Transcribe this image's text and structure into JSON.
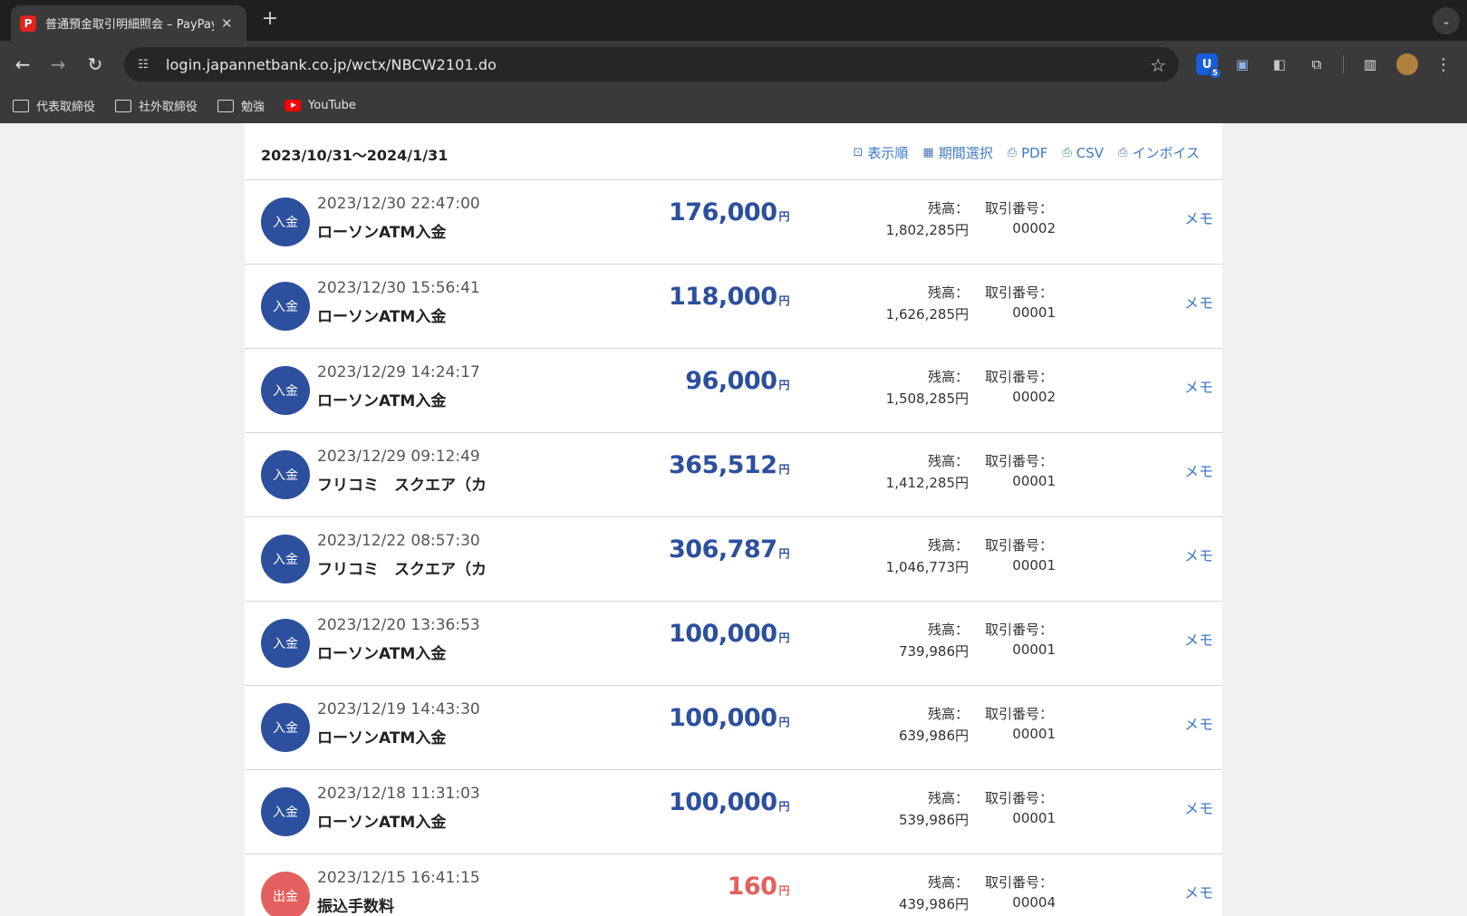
{
  "browser": {
    "tab_title": "普通預金取引明細照会 – PayPay銀行",
    "url": "login.japannetbank.co.jp/wctx/NBCW2101.do",
    "bookmarks": [
      "代表取締役",
      "社外取締役",
      "勉強",
      "YouTube"
    ],
    "extension_badge": "5"
  },
  "header": {
    "period": "2023/10/31〜2024/1/31",
    "actions": [
      "表示順",
      "期間選択",
      "PDF",
      "CSV",
      "インボイス"
    ]
  },
  "labels": {
    "balance": "残高：",
    "tx_no": "取引番号：",
    "memo": "メモ",
    "yen": "円"
  },
  "transactions": [
    {
      "type": "入金",
      "kind": "in",
      "datetime": "2023/12/30 22:47:00",
      "description": "ローソンATM入金",
      "amount": "176,000",
      "balance": "1,802,285円",
      "tx_no": "00002"
    },
    {
      "type": "入金",
      "kind": "in",
      "datetime": "2023/12/30 15:56:41",
      "description": "ローソンATM入金",
      "amount": "118,000",
      "balance": "1,626,285円",
      "tx_no": "00001"
    },
    {
      "type": "入金",
      "kind": "in",
      "datetime": "2023/12/29 14:24:17",
      "description": "ローソンATM入金",
      "amount": "96,000",
      "balance": "1,508,285円",
      "tx_no": "00002"
    },
    {
      "type": "入金",
      "kind": "in",
      "datetime": "2023/12/29 09:12:49",
      "description": "フリコミ　スクエア（カ",
      "amount": "365,512",
      "balance": "1,412,285円",
      "tx_no": "00001"
    },
    {
      "type": "入金",
      "kind": "in",
      "datetime": "2023/12/22 08:57:30",
      "description": "フリコミ　スクエア（カ",
      "amount": "306,787",
      "balance": "1,046,773円",
      "tx_no": "00001"
    },
    {
      "type": "入金",
      "kind": "in",
      "datetime": "2023/12/20 13:36:53",
      "description": "ローソンATM入金",
      "amount": "100,000",
      "balance": "739,986円",
      "tx_no": "00001"
    },
    {
      "type": "入金",
      "kind": "in",
      "datetime": "2023/12/19 14:43:30",
      "description": "ローソンATM入金",
      "amount": "100,000",
      "balance": "639,986円",
      "tx_no": "00001"
    },
    {
      "type": "入金",
      "kind": "in",
      "datetime": "2023/12/18 11:31:03",
      "description": "ローソンATM入金",
      "amount": "100,000",
      "balance": "539,986円",
      "tx_no": "00001"
    },
    {
      "type": "出金",
      "kind": "out",
      "datetime": "2023/12/15 16:41:15",
      "description": "振込手数料",
      "amount": "160",
      "balance": "439,986円",
      "tx_no": "00004"
    }
  ],
  "colors": {
    "deposit": "#2c4f9e",
    "withdrawal": "#e4605e",
    "link": "#3d79c7"
  }
}
